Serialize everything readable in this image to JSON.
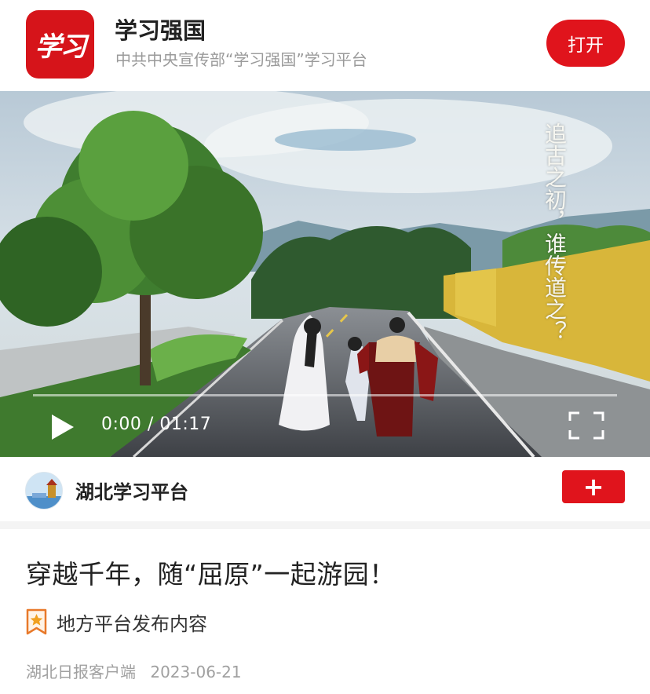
{
  "app": {
    "logo_text": "学习",
    "name": "学习强国",
    "description": "中共中央宣传部“学习强国”学习平台",
    "open_button": "打开"
  },
  "video": {
    "overlay_text": "追古之初，谁传道之？",
    "current_time": "0:00",
    "separator": "/",
    "duration": "01:17",
    "progress": 0
  },
  "account": {
    "name": "湖北学习平台",
    "follow_button": "+"
  },
  "article": {
    "title": "穿越千年，随“屈原”一起游园！",
    "tag": "地方平台发布内容",
    "source": "湖北日报客户端",
    "date": "2023-06-21"
  },
  "colors": {
    "brand_red": "#e0141c",
    "muted_text": "#9a9a9a"
  }
}
